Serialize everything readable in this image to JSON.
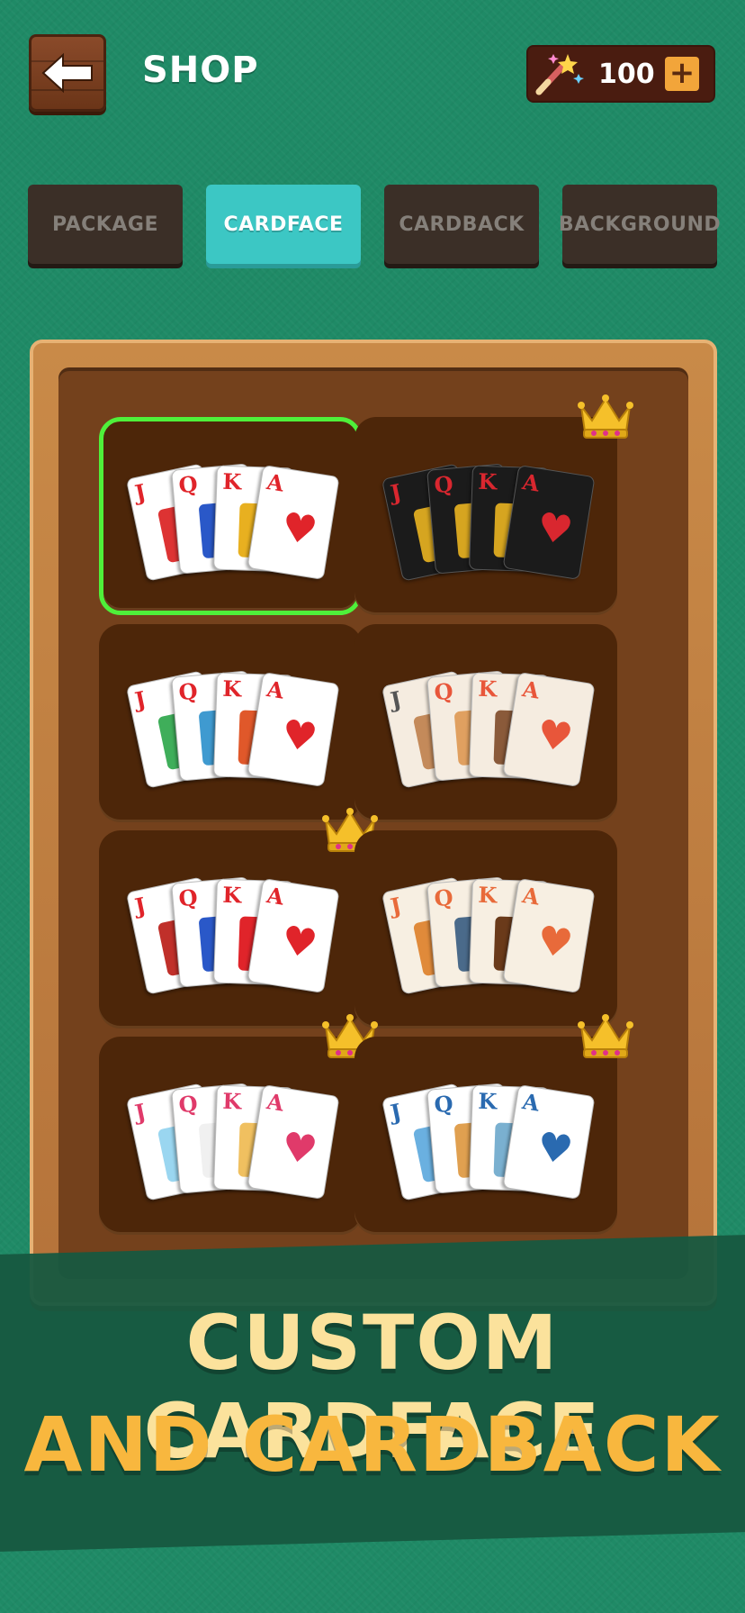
{
  "header": {
    "back_icon": "arrow-left-icon",
    "title": "SHOP",
    "currency": {
      "icon": "magic-wand-icon",
      "value": "100",
      "add_icon": "plus-icon"
    }
  },
  "tabs": [
    {
      "label": "PACKAGE",
      "active": false
    },
    {
      "label": "CARDFACE",
      "active": true
    },
    {
      "label": "CARDBACK",
      "active": false
    },
    {
      "label": "BACKGROUND",
      "active": false
    }
  ],
  "cardfaces": [
    {
      "style": "classic",
      "selected": true,
      "premium": false,
      "ranks": [
        "J",
        "Q",
        "K",
        "A"
      ]
    },
    {
      "style": "black-gold",
      "selected": false,
      "premium": true,
      "ranks": [
        "J",
        "Q",
        "K",
        "A"
      ]
    },
    {
      "style": "dragons",
      "selected": false,
      "premium": false,
      "ranks": [
        "J",
        "Q",
        "K",
        "A"
      ]
    },
    {
      "style": "animals-cream",
      "selected": false,
      "premium": false,
      "ranks": [
        "J",
        "Q",
        "K",
        "A"
      ]
    },
    {
      "style": "cartoon-royals",
      "selected": false,
      "premium": true,
      "ranks": [
        "J",
        "Q",
        "K",
        "A"
      ]
    },
    {
      "style": "birds",
      "selected": false,
      "premium": false,
      "ranks": [
        "J",
        "Q",
        "K",
        "A"
      ]
    },
    {
      "style": "cute-pets",
      "selected": false,
      "premium": true,
      "ranks": [
        "J",
        "Q",
        "K",
        "A"
      ]
    },
    {
      "style": "landscapes",
      "selected": false,
      "premium": true,
      "ranks": [
        "J",
        "Q",
        "K",
        "A"
      ]
    }
  ],
  "banner": {
    "line1": "CUSTOM CARDFACE",
    "line2": "AND CARDBACK"
  },
  "colors": {
    "table_green": "#1f8a66",
    "tab_active": "#3cc7c4",
    "tab_inactive": "#3b2f27",
    "selection": "#4ff03a",
    "banner_line1": "#fbe29c",
    "banner_line2": "#f8b73e"
  }
}
